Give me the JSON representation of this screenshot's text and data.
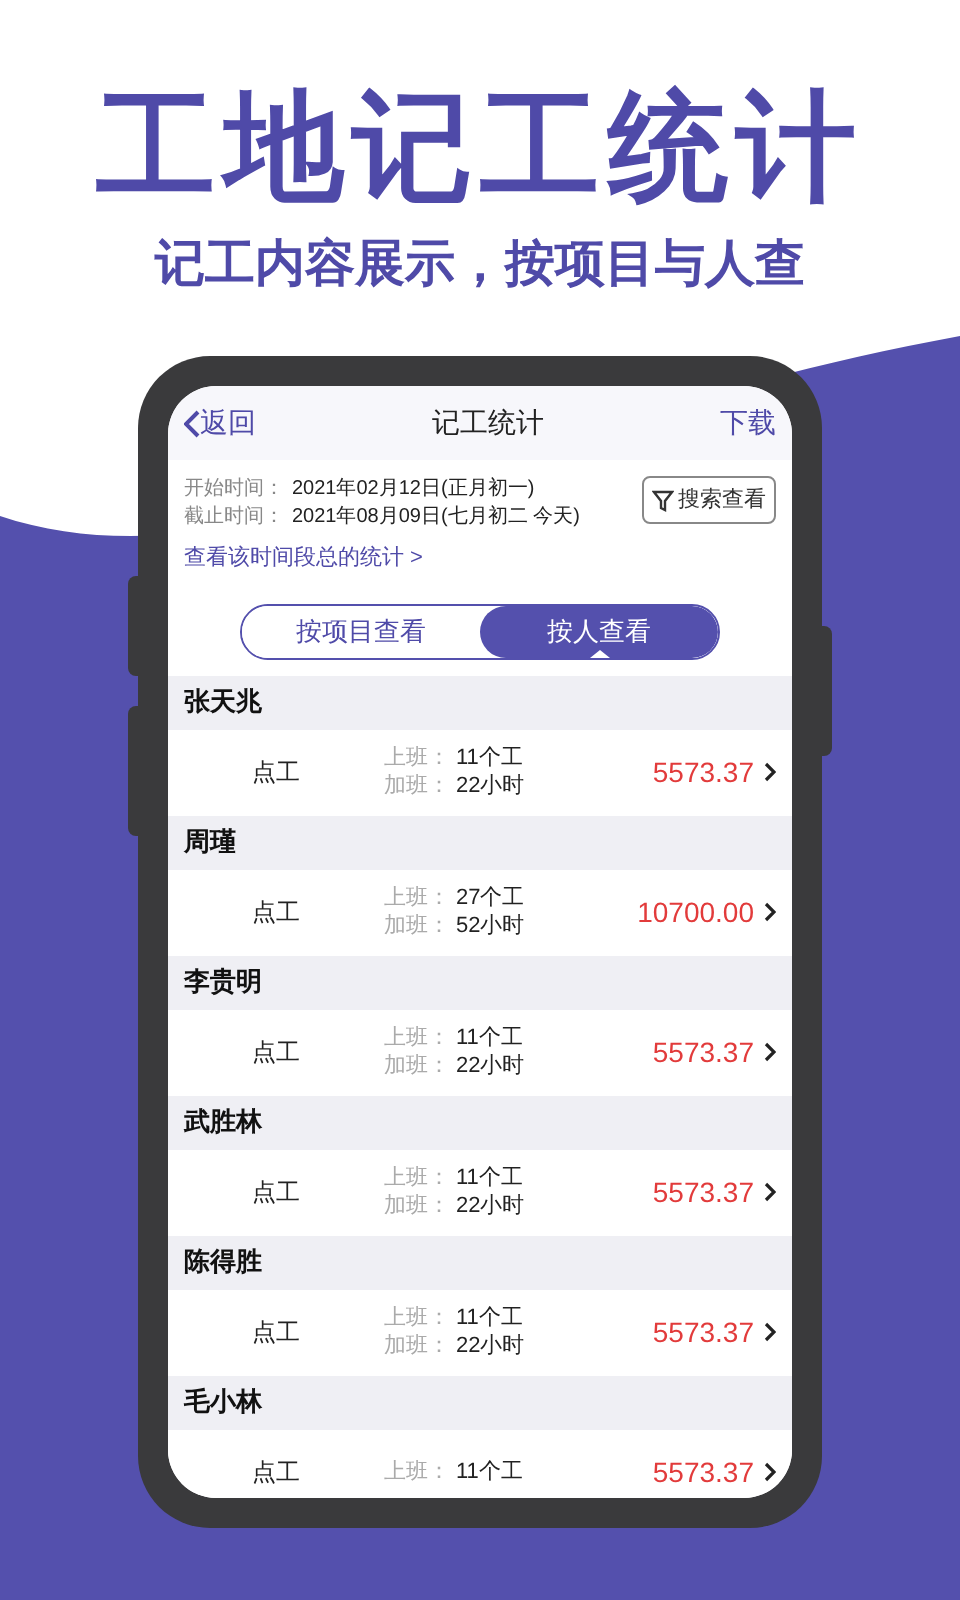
{
  "headline": "工地记工统计",
  "subheadline": "记工内容展示，按项目与人查",
  "nav": {
    "back": "返回",
    "title": "记工统计",
    "action": "下载"
  },
  "filters": [
    {
      "label": "开始时间：",
      "value": "2021年02月12日(正月初一)"
    },
    {
      "label": "截止时间：",
      "value": "2021年08月09日(七月初二 今天)"
    }
  ],
  "search_button": "搜索查看",
  "summary_link": "查看该时间段总的统计 >",
  "tabs": [
    {
      "label": "按项目查看",
      "selected": false
    },
    {
      "label": "按人查看",
      "selected": true
    }
  ],
  "people": [
    {
      "name": "张天兆",
      "type": "点工",
      "work_label": "上班：",
      "work": "11个工",
      "overtime_label": "加班：",
      "overtime": "22小时",
      "amount": "5573.37"
    },
    {
      "name": "周瑾",
      "type": "点工",
      "work_label": "上班：",
      "work": "27个工",
      "overtime_label": "加班：",
      "overtime": "52小时",
      "amount": "10700.00"
    },
    {
      "name": "李贵明",
      "type": "点工",
      "work_label": "上班：",
      "work": "11个工",
      "overtime_label": "加班：",
      "overtime": "22小时",
      "amount": "5573.37"
    },
    {
      "name": "武胜林",
      "type": "点工",
      "work_label": "上班：",
      "work": "11个工",
      "overtime_label": "加班：",
      "overtime": "22小时",
      "amount": "5573.37"
    },
    {
      "name": "陈得胜",
      "type": "点工",
      "work_label": "上班：",
      "work": "11个工",
      "overtime_label": "加班：",
      "overtime": "22小时",
      "amount": "5573.37"
    },
    {
      "name": "毛小林",
      "type": "点工",
      "work_label": "上班：",
      "work": "11个工",
      "amount": "5573.37"
    }
  ]
}
